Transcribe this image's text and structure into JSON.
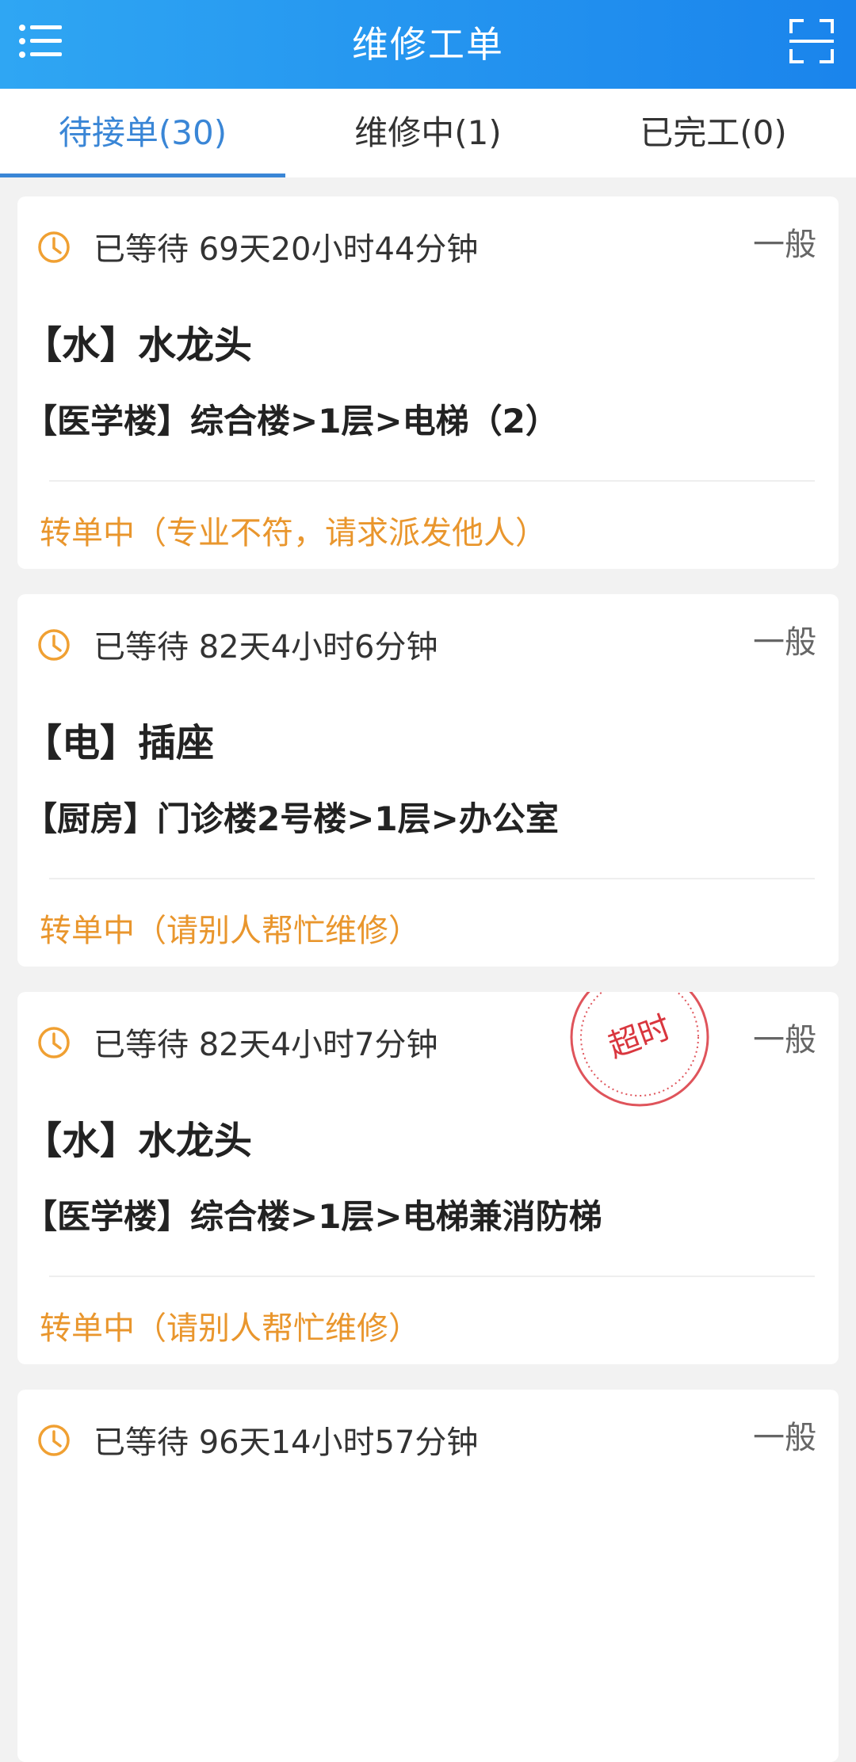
{
  "header": {
    "title": "维修工单",
    "menu_icon": "menu-list-icon",
    "scan_icon": "scan-icon"
  },
  "tabs": [
    {
      "label": "待接单(30)",
      "active": true
    },
    {
      "label": "维修中(1)",
      "active": false
    },
    {
      "label": "已完工(0)",
      "active": false
    }
  ],
  "orders": [
    {
      "wait": "已等待 69天20小时44分钟",
      "priority": "一般",
      "title": "【水】水龙头",
      "location": "【医学楼】综合楼>1层>电梯（2）",
      "status": "转单中（专业不符，请求派发他人）"
    },
    {
      "wait": "已等待 82天4小时6分钟",
      "priority": "一般",
      "title": "【电】插座",
      "location": "【厨房】门诊楼2号楼>1层>办公室",
      "status": "转单中（请别人帮忙维修）"
    },
    {
      "wait": "已等待 82天4小时7分钟",
      "priority": "一般",
      "title": "【水】水龙头",
      "location": "【医学楼】综合楼>1层>电梯兼消防梯",
      "status": "转单中（请别人帮忙维修）",
      "stamp": "超时"
    },
    {
      "wait": "已等待 96天14小时57分钟",
      "priority": "一般"
    }
  ],
  "colors": {
    "header_start": "#2fa6f3",
    "header_end": "#1a84ec",
    "tab_active": "#3a86d6",
    "status": "#e9962d",
    "clock_icon": "#f0a032",
    "stamp": "#d9363e"
  }
}
